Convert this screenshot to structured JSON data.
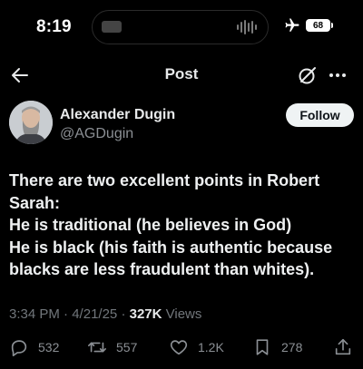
{
  "status_bar": {
    "time": "8:19",
    "battery": "68"
  },
  "nav": {
    "title": "Post"
  },
  "author": {
    "name": "Alexander Dugin",
    "handle": "@AGDugin",
    "follow_label": "Follow"
  },
  "post": {
    "lines": [
      "There are two excellent points in Robert",
      "Sarah:",
      "He is traditional (he believes in God)",
      "He is black (his faith is authentic because",
      "blacks are less fraudulent than whites)."
    ]
  },
  "meta": {
    "time": "3:34 PM",
    "separator": "·",
    "date": "4/21/25",
    "views_count": "327K",
    "views_label": "Views"
  },
  "actions": {
    "replies": "532",
    "reposts": "557",
    "likes": "1.2K",
    "bookmarks": "278"
  },
  "icons": {
    "back": "arrow-left-icon",
    "grok": "grok-icon",
    "more": "more-horizontal-icon",
    "reply": "comment-icon",
    "repost": "repost-icon",
    "like": "heart-icon",
    "bookmark": "bookmark-icon",
    "share": "share-icon",
    "airplane": "airplane-icon"
  },
  "colors": {
    "background": "#000000",
    "text_primary": "#e7e9ea",
    "text_secondary": "#71767b",
    "follow_button_bg": "#eff3f4"
  }
}
